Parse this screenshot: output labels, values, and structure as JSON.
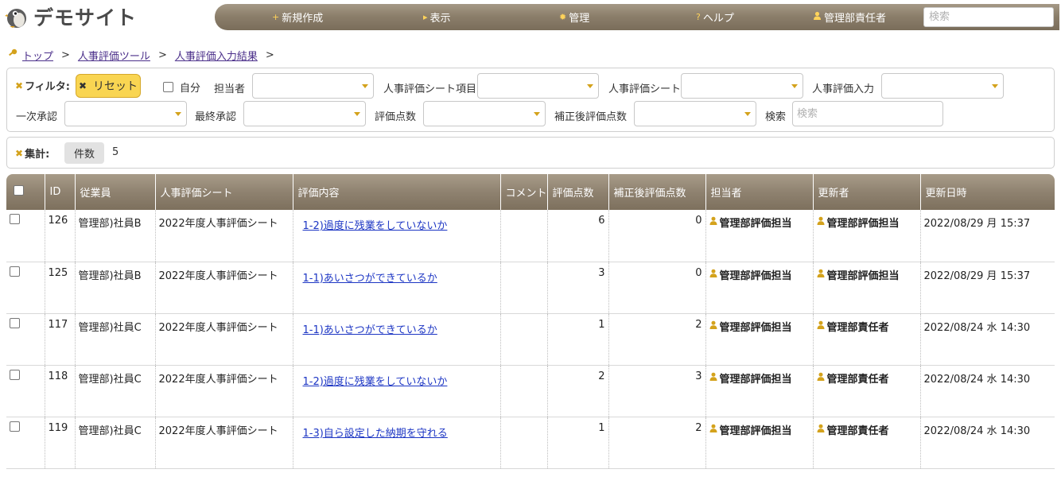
{
  "logo": {
    "text": "デモサイト"
  },
  "nav": {
    "items": [
      {
        "icon": "+",
        "label": "新規作成"
      },
      {
        "icon": "▸",
        "label": "表示"
      },
      {
        "icon": "✹",
        "label": "管理"
      },
      {
        "icon": "?",
        "label": "ヘルプ"
      },
      {
        "icon": "user-icon",
        "label": "管理部責任者"
      }
    ],
    "search_placeholder": "検索"
  },
  "breadcrumb": {
    "items": [
      "トップ",
      "人事評価ツール",
      "人事評価入力結果"
    ],
    "separator": ">"
  },
  "filter": {
    "title": "フィルタ:",
    "reset_label": "リセット",
    "self_label": "自分",
    "self_checked": false,
    "fields": [
      {
        "label": "担当者",
        "value": ""
      },
      {
        "label": "人事評価シート項目",
        "value": ""
      },
      {
        "label": "人事評価シート",
        "value": ""
      },
      {
        "label": "人事評価入力",
        "value": ""
      },
      {
        "label": "一次承認",
        "value": ""
      },
      {
        "label": "最終承認",
        "value": ""
      },
      {
        "label": "評価点数",
        "value": ""
      },
      {
        "label": "補正後評価点数",
        "value": ""
      }
    ],
    "search_label": "検索",
    "search_placeholder": "検索"
  },
  "aggregation": {
    "title": "集計:",
    "badge": "件数",
    "count": "5"
  },
  "table": {
    "columns": [
      "",
      "ID",
      "従業員",
      "人事評価シート",
      "評価内容",
      "コメント",
      "評価点数",
      "補正後評価点数",
      "担当者",
      "更新者",
      "更新日時"
    ],
    "rows": [
      {
        "id": "126",
        "employee": "管理部)社員B",
        "sheet": "2022年度人事評価シート",
        "content": "1-2)過度に残業をしていないか",
        "comment": "",
        "score": "6",
        "adjusted": "0",
        "assignee": "管理部評価担当",
        "updater": "管理部評価担当",
        "updated": "2022/08/29 月 15:37"
      },
      {
        "id": "125",
        "employee": "管理部)社員B",
        "sheet": "2022年度人事評価シート",
        "content": "1-1)あいさつができているか",
        "comment": "",
        "score": "3",
        "adjusted": "0",
        "assignee": "管理部評価担当",
        "updater": "管理部評価担当",
        "updated": "2022/08/29 月 15:37"
      },
      {
        "id": "117",
        "employee": "管理部)社員C",
        "sheet": "2022年度人事評価シート",
        "content": "1-1)あいさつができているか",
        "comment": "",
        "score": "1",
        "adjusted": "2",
        "assignee": "管理部評価担当",
        "updater": "管理部責任者",
        "updated": "2022/08/24 水 14:30"
      },
      {
        "id": "118",
        "employee": "管理部)社員C",
        "sheet": "2022年度人事評価シート",
        "content": "1-2)過度に残業をしていないか",
        "comment": "",
        "score": "2",
        "adjusted": "3",
        "assignee": "管理部評価担当",
        "updater": "管理部責任者",
        "updated": "2022/08/24 水 14:30"
      },
      {
        "id": "119",
        "employee": "管理部)社員C",
        "sheet": "2022年度人事評価シート",
        "content": "1-3)自ら設定した納期を守れる",
        "comment": "",
        "score": "1",
        "adjusted": "2",
        "assignee": "管理部評価担当",
        "updater": "管理部責任者",
        "updated": "2022/08/24 水 14:30"
      }
    ]
  },
  "colors": {
    "header_bar": "#8c7f6b",
    "accent_yellow": "#f9d552",
    "icon_gold": "#d4a21c",
    "link_blue": "#1d36c4"
  }
}
